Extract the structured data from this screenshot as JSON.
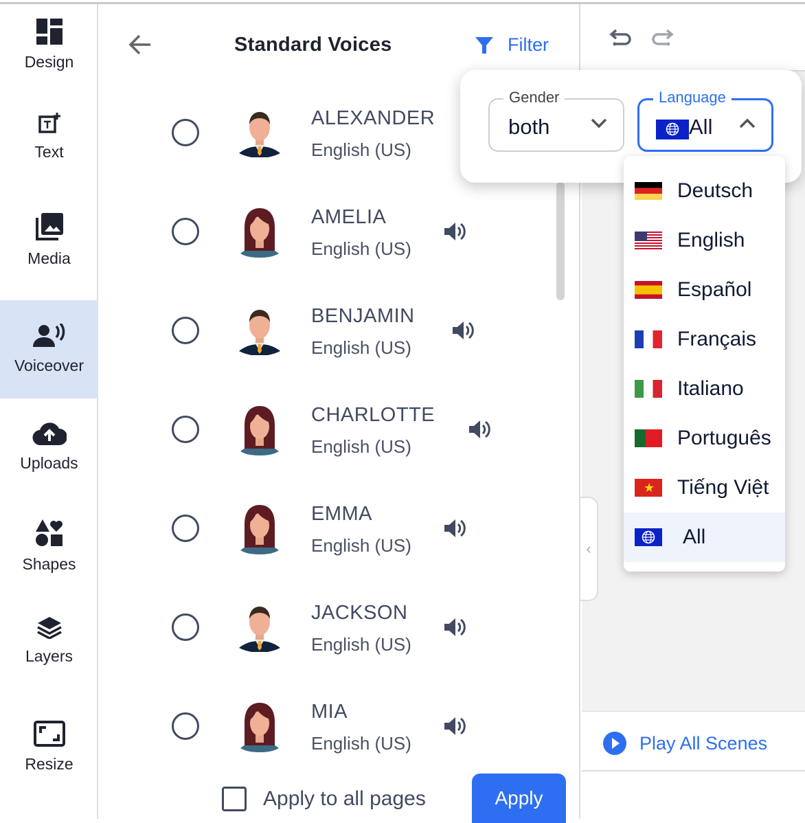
{
  "sidebar": {
    "items": [
      {
        "label": "Design",
        "icon": "design-grid-icon"
      },
      {
        "label": "Text",
        "icon": "text-add-icon"
      },
      {
        "label": "Media",
        "icon": "media-images-icon"
      },
      {
        "label": "Voiceover",
        "icon": "voiceover-icon",
        "active": true
      },
      {
        "label": "Uploads",
        "icon": "cloud-upload-icon"
      },
      {
        "label": "Shapes",
        "icon": "shapes-icon"
      },
      {
        "label": "Layers",
        "icon": "layers-icon"
      },
      {
        "label": "Resize",
        "icon": "resize-icon"
      }
    ]
  },
  "panel": {
    "title": "Standard Voices",
    "filter_label": "Filter",
    "voices": [
      {
        "name": "ALEXANDER",
        "language": "English (US)",
        "gender": "male"
      },
      {
        "name": "AMELIA",
        "language": "English (US)",
        "gender": "female"
      },
      {
        "name": "BENJAMIN",
        "language": "English (US)",
        "gender": "male"
      },
      {
        "name": "CHARLOTTE",
        "language": "English (US)",
        "gender": "female"
      },
      {
        "name": "EMMA",
        "language": "English (US)",
        "gender": "female"
      },
      {
        "name": "JACKSON",
        "language": "English (US)",
        "gender": "male"
      },
      {
        "name": "MIA",
        "language": "English (US)",
        "gender": "female"
      }
    ],
    "apply_all_label": "Apply to all pages",
    "apply_all_checked": false,
    "apply_label": "Apply"
  },
  "filter_popup": {
    "gender_label": "Gender",
    "gender_value": "both",
    "language_label": "Language",
    "language_value": "All",
    "language_options": [
      {
        "label": "Deutsch",
        "flag": "de"
      },
      {
        "label": "English",
        "flag": "us"
      },
      {
        "label": "Español",
        "flag": "es"
      },
      {
        "label": "Français",
        "flag": "fr"
      },
      {
        "label": "Italiano",
        "flag": "it"
      },
      {
        "label": "Português",
        "flag": "pt"
      },
      {
        "label": "Tiếng Việt",
        "flag": "vn"
      },
      {
        "label": "All",
        "flag": "globe",
        "selected": true
      }
    ]
  },
  "right": {
    "play_all_label": "Play All Scenes"
  },
  "colors": {
    "accent": "#2d6ff0",
    "active_sidebar": "#d8e3f5"
  }
}
